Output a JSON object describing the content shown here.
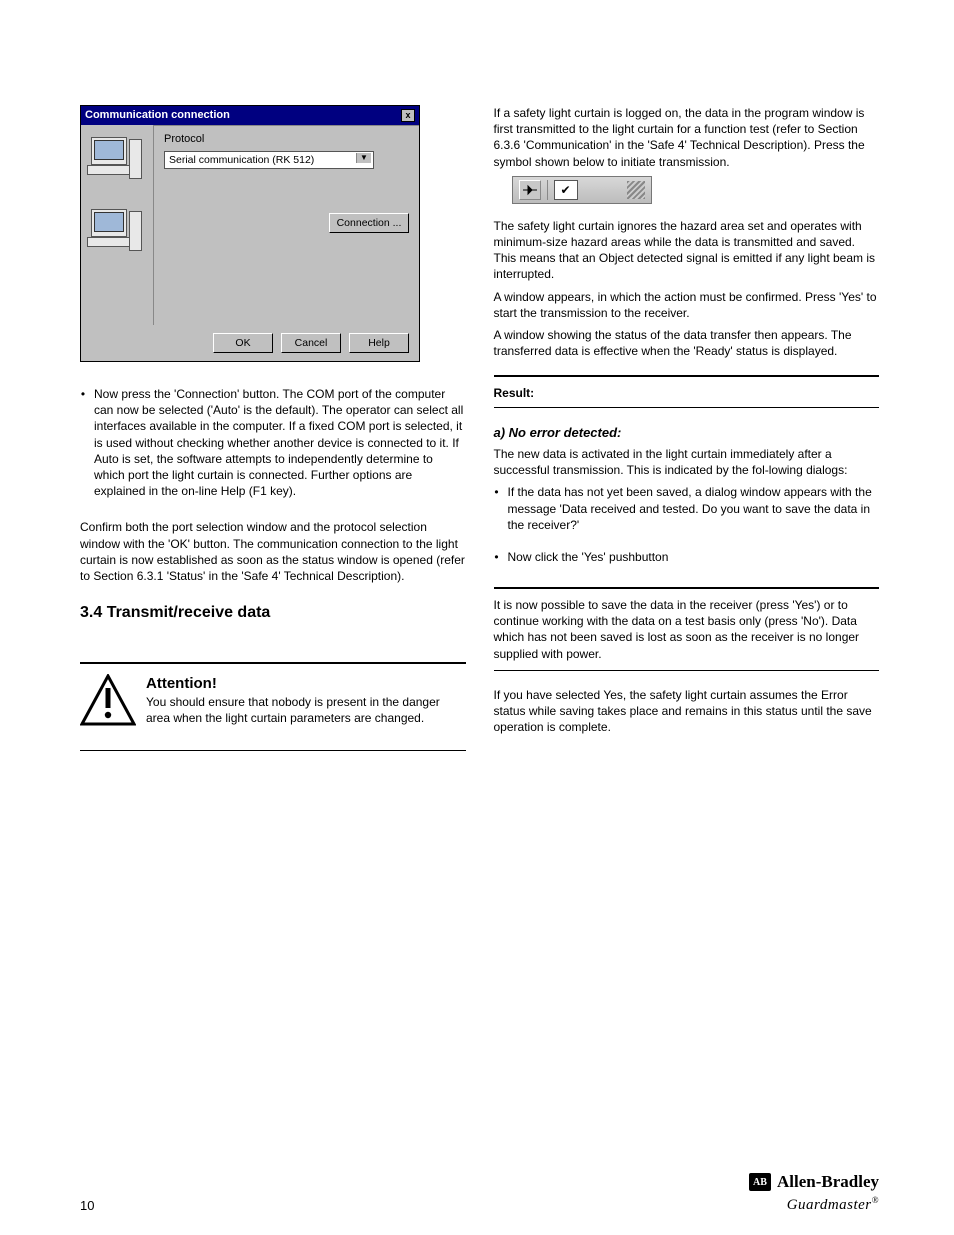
{
  "dialog": {
    "title": "Communication connection",
    "close_glyph": "x",
    "group_label": "Protocol",
    "select_value": "Serial communication (RK 512)",
    "connection_btn": "Connection ...",
    "ok": "OK",
    "cancel": "Cancel",
    "help": "Help"
  },
  "left": {
    "bullet1": "Now press the 'Connection' button. The COM port of the computer can now be selected ('Auto' is the default). The operator can select all interfaces available in the computer. If a fixed COM port is selected, it is used without checking whether another device is connected to it. If Auto is set, the software attempts to independently determine to which port the light curtain is connected. Further options are explained in the on-line Help (F1 key).",
    "para_after_bullet": "Confirm both the port selection window and the protocol selection window with the 'OK' button. The communication connection to the light curtain is now established as soon as the status window is opened (refer to Section 6.3.1 'Status' in the 'Safe 4' Technical Description).",
    "h2": "3.4 Transmit/receive data",
    "attention_title": "Attention!",
    "attention_text": "You should ensure that nobody is present in the danger area when the light curtain parameters are changed."
  },
  "right": {
    "intro1": "If a safety light curtain is logged on, the data in the program window is first transmitted to the light curtain for a function test (refer to Section 6.3.6 'Communication' in the 'Safe 4' Technical Description). Press the symbol shown below to initiate transmission.",
    "intro2": "The safety light curtain ignores the hazard area set and operates with minimum-size hazard areas while the data is transmitted and saved. This means that an Object detected signal is emitted if any light beam is interrupted.",
    "intro3": "A window appears, in which the action must be confirmed. Press 'Yes' to start the transmission to the receiver.",
    "intro4": "A window showing the status of the data transfer then appears. The transferred data is effective when the 'Ready' status is displayed.",
    "h_result": "Result:",
    "step_a_title": "a) No error detected:",
    "step_a_text": "The new data is activated in the light curtain immediately after a successful transmission. This is indicated by the fol-lowing dialogs:",
    "step_a_b1": "If the data has not yet been saved, a dialog window appears with the message 'Data received and tested. Do you want to save the data in the receiver?'",
    "step_a_b2": "Now click the 'Yes' pushbutton",
    "rule_text": "It is now possible to save the data in the receiver (press 'Yes') or to continue working with the data on a test basis only (press 'No'). Data which has not been saved is lost as soon as the receiver is no longer supplied with power.",
    "after_rule": "If you have selected Yes, the safety light curtain assumes the Error status while saving takes place and remains in this status until the save operation is complete."
  },
  "footer": {
    "page": "10",
    "brand_code": "AB",
    "brand": "Allen-Bradley",
    "brand_sub": "Guardmaster",
    "brand_tm": "®"
  }
}
